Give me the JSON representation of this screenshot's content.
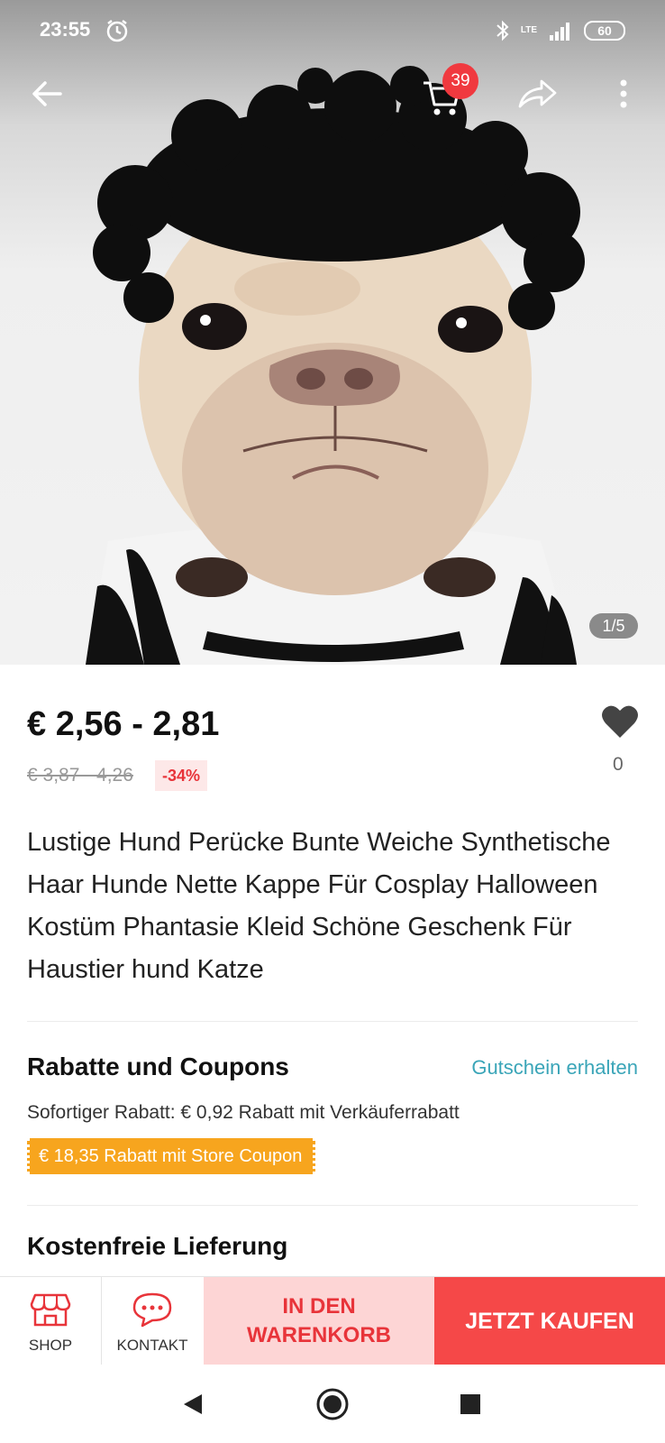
{
  "status_bar": {
    "time": "23:55",
    "network": "LTE",
    "battery": "60"
  },
  "nav": {
    "cart_count": "39"
  },
  "gallery": {
    "counter": "1/5"
  },
  "product": {
    "price": "€ 2,56 - 2,81",
    "old_price": "€ 3,87 - 4,26",
    "discount": "-34%",
    "wishlist_count": "0",
    "title": "Lustige Hund Perücke Bunte Weiche Synthetische Haar Hunde Nette Kappe Für Cosplay Halloween Kostüm Phantasie Kleid Schöne Geschenk Für Haustier hund Katze"
  },
  "coupons": {
    "heading": "Rabatte und Coupons",
    "link": "Gutschein erhalten",
    "instant_discount": "Sofortiger Rabatt: € 0,92 Rabatt mit Verkäuferrabatt",
    "store_coupon": "€ 18,35 Rabatt mit Store Coupon"
  },
  "shipping": {
    "heading": "Kostenfreie Lieferung"
  },
  "action_bar": {
    "shop_label": "SHOP",
    "contact_label": "KONTAKT",
    "add_to_cart_label": "IN DEN WARENKORB",
    "buy_now_label": "JETZT KAUFEN"
  },
  "colors": {
    "accent_red": "#f54848",
    "cart_button_bg": "#fdd5d5",
    "coupon_orange": "#f7a51e",
    "link_teal": "#3aa5b8"
  }
}
